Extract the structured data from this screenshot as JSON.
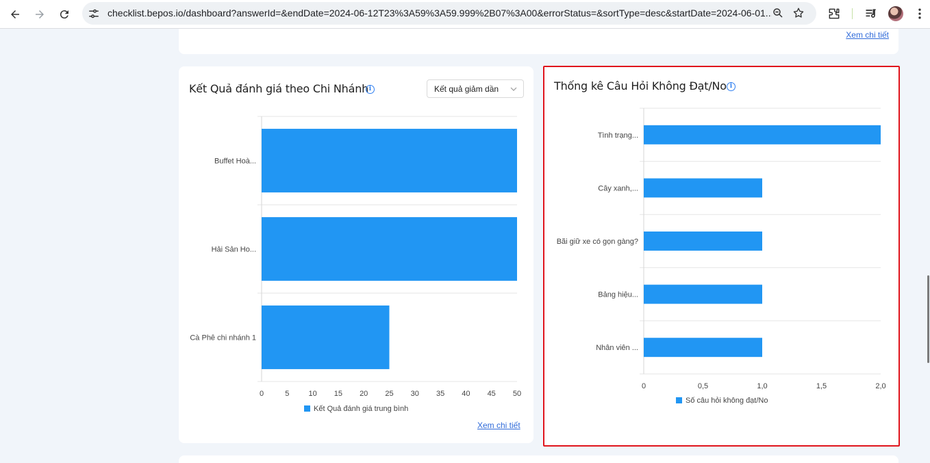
{
  "browser": {
    "url": "checklist.bepos.io/dashboard?answerId=&endDate=2024-06-12T23%3A59%3A59.999%2B07%3A00&errorStatus=&sortType=desc&startDate=2024-06-01...",
    "icons": [
      "back-icon",
      "forward-icon",
      "reload-icon",
      "site-settings-icon",
      "zoom-icon",
      "bookmark-star-icon",
      "extensions-icon",
      "media-control-icon",
      "profile-avatar",
      "menu-icon"
    ]
  },
  "top_card": {
    "link_label": "Xem chi tiết"
  },
  "branch_card": {
    "title": "Kết Quả đánh giá theo Chi Nhánh",
    "info_symbol": "i",
    "sort_select": {
      "value": "Kết quả giảm dần"
    },
    "link_label": "Xem chi tiết"
  },
  "question_card": {
    "title": "Thống kê Câu Hỏi Không Đạt/No",
    "info_symbol": "i"
  },
  "chart_data": [
    {
      "type": "bar",
      "orientation": "horizontal",
      "categories": [
        "Buffet Hoà...",
        "Hải Sản Ho...",
        "Cà Phê chi nhánh 1"
      ],
      "series": [
        {
          "name": "Kết Quả đánh giá trung bình",
          "values": [
            50,
            50,
            25
          ]
        }
      ],
      "xlim": [
        0,
        50
      ],
      "ticks": [
        "0",
        "5",
        "10",
        "15",
        "20",
        "25",
        "30",
        "35",
        "40",
        "45",
        "50"
      ],
      "tick_values": [
        0,
        5,
        10,
        15,
        20,
        25,
        30,
        35,
        40,
        45,
        50
      ],
      "grid": true,
      "legend": "bottom",
      "color": "#2196f3"
    },
    {
      "type": "bar",
      "orientation": "horizontal",
      "categories": [
        "Tình trạng...",
        "Cây xanh,...",
        "Bãi giữ xe có gọn  gàng?",
        "Bảng hiệu...",
        "Nhân viên ..."
      ],
      "series": [
        {
          "name": "Số câu hỏi không đạt/No",
          "values": [
            2,
            1,
            1,
            1,
            1
          ]
        }
      ],
      "xlim": [
        0,
        2
      ],
      "ticks": [
        "0",
        "0,5",
        "1,0",
        "1,5",
        "2,0"
      ],
      "tick_values": [
        0,
        0.5,
        1,
        1.5,
        2
      ],
      "grid": true,
      "legend": "bottom",
      "color": "#2196f3"
    }
  ]
}
